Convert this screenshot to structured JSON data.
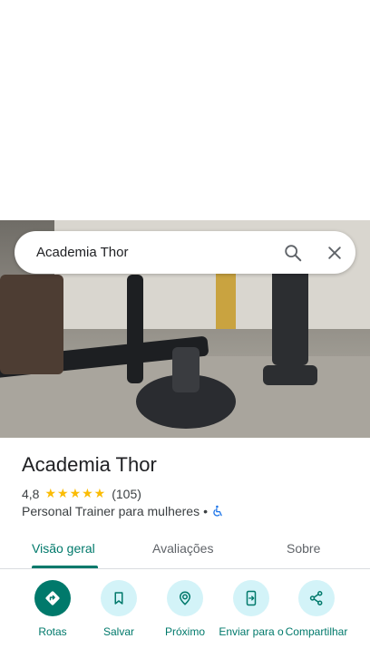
{
  "search": {
    "query": "Academia Thor"
  },
  "place": {
    "name": "Academia Thor",
    "rating": "4,8",
    "stars": "★★★★★",
    "review_count": "(105)",
    "category": "Personal Trainer para mulheres",
    "separator": "•"
  },
  "tabs": [
    {
      "label": "Visão geral",
      "active": true
    },
    {
      "label": "Avaliações",
      "active": false
    },
    {
      "label": "Sobre",
      "active": false
    }
  ],
  "actions": [
    {
      "label": "Rotas",
      "icon": "directions-icon"
    },
    {
      "label": "Salvar",
      "icon": "bookmark-icon"
    },
    {
      "label": "Próximo",
      "icon": "nearby-icon"
    },
    {
      "label": "Enviar para o",
      "icon": "send-to-phone-icon"
    },
    {
      "label": "Compartilhar",
      "icon": "share-icon"
    }
  ],
  "colors": {
    "accent": "#00796b",
    "accent_light": "#d3f3f8",
    "star": "#fbbc04",
    "accessibility": "#1a73e8"
  }
}
